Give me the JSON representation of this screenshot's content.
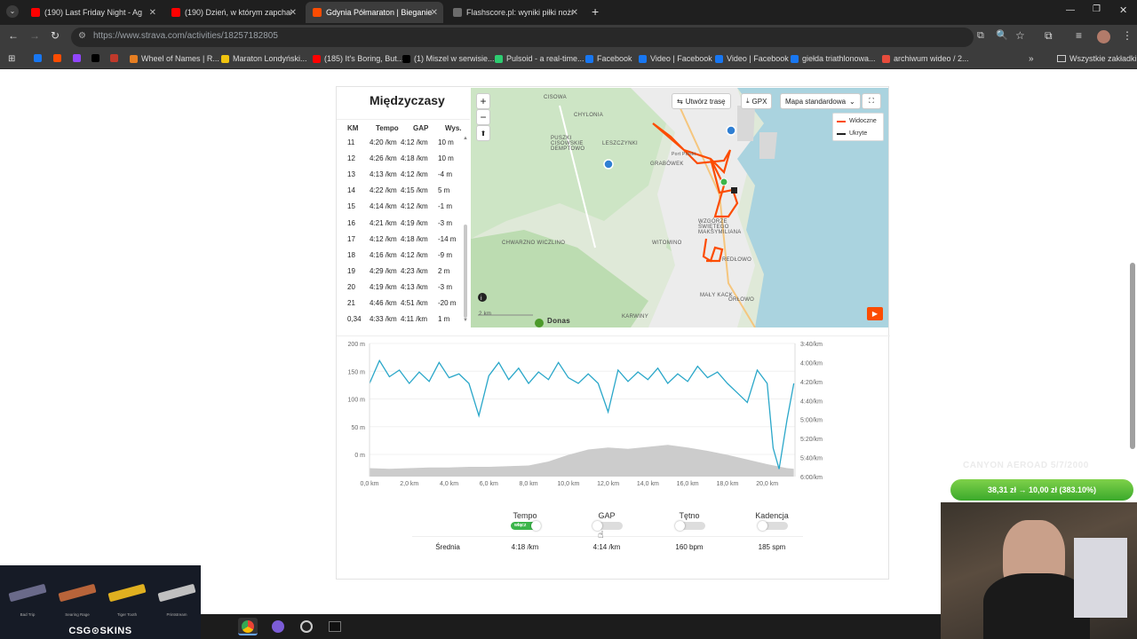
{
  "browser": {
    "tabs": [
      {
        "title": "(190) Last Friday Night - Ag",
        "icon": "youtube-icon",
        "color": "#ff0000",
        "active": false
      },
      {
        "title": "(190) Dzień, w którym zapchał",
        "icon": "youtube-icon",
        "color": "#ff0000",
        "active": false
      },
      {
        "title": "Gdynia Półmaraton | Bieganie |",
        "icon": "strava-icon",
        "color": "#fc4c02",
        "active": true
      },
      {
        "title": "Flashscore.pl: wyniki piłki nożne",
        "icon": "flashscore-icon",
        "color": "#6c6c6c",
        "active": false
      }
    ],
    "url": "https://www.strava.com/activities/18257182805",
    "bookmarks": [
      {
        "label": "",
        "icon": "facebook-icon",
        "color": "#1877f2"
      },
      {
        "label": "",
        "icon": "strava-icon",
        "color": "#fc4c02"
      },
      {
        "label": "",
        "icon": "twitch-icon",
        "color": "#9146ff"
      },
      {
        "label": "",
        "icon": "x-icon",
        "color": "#000000"
      },
      {
        "label": "",
        "icon": "bookmark-icon",
        "color": "#c0392b"
      },
      {
        "label": "Wheel of Names | R...",
        "icon": "wheel-icon",
        "color": "#e67e22"
      },
      {
        "label": "Maraton Londyński...",
        "icon": "runner-icon",
        "color": "#f1c40f"
      },
      {
        "label": "(185) It's Boring, But...",
        "icon": "youtube-icon",
        "color": "#ff0000"
      },
      {
        "label": "(1) Miszel w serwisie...",
        "icon": "x-icon",
        "color": "#000000"
      },
      {
        "label": "Pulsoid - a real-time...",
        "icon": "pulsoid-icon",
        "color": "#2ecc71"
      },
      {
        "label": "Facebook",
        "icon": "facebook-icon",
        "color": "#1877f2"
      },
      {
        "label": "Video | Facebook",
        "icon": "facebook-icon",
        "color": "#1877f2"
      },
      {
        "label": "Video | Facebook",
        "icon": "facebook-icon",
        "color": "#1877f2"
      },
      {
        "label": "giełda triathlonowa...",
        "icon": "facebook-icon",
        "color": "#1877f2"
      },
      {
        "label": "archiwum wideo / 2...",
        "icon": "live-icon",
        "color": "#e74c3c"
      }
    ],
    "all_bookmarks": "Wszystkie zakładki"
  },
  "splits": {
    "title": "Międzyczasy",
    "headers": [
      "KM",
      "Tempo",
      "GAP",
      "Wys."
    ],
    "rows": [
      [
        "11",
        "4:20 /km",
        "4:12 /km",
        "10 m"
      ],
      [
        "12",
        "4:26 /km",
        "4:18 /km",
        "10 m"
      ],
      [
        "13",
        "4:13 /km",
        "4:12 /km",
        "-4 m"
      ],
      [
        "14",
        "4:22 /km",
        "4:15 /km",
        "5 m"
      ],
      [
        "15",
        "4:14 /km",
        "4:12 /km",
        "-1 m"
      ],
      [
        "16",
        "4:21 /km",
        "4:19 /km",
        "-3 m"
      ],
      [
        "17",
        "4:12 /km",
        "4:18 /km",
        "-14 m"
      ],
      [
        "18",
        "4:16 /km",
        "4:12 /km",
        "-9 m"
      ],
      [
        "19",
        "4:29 /km",
        "4:23 /km",
        "2 m"
      ],
      [
        "20",
        "4:19 /km",
        "4:13 /km",
        "-3 m"
      ],
      [
        "21",
        "4:46 /km",
        "4:51 /km",
        "-20 m"
      ],
      [
        "0,34",
        "4:33 /km",
        "4:11 /km",
        "1 m"
      ]
    ]
  },
  "map": {
    "create_route": "Utwórz trasę",
    "gpx": "GPX",
    "map_type": "Mapa standardowa",
    "legend": [
      {
        "label": "Widoczne",
        "color": "#fc4c02"
      },
      {
        "label": "Ukryte",
        "color": "#222222"
      }
    ],
    "labels": [
      "CISOWA",
      "CHYLONIA",
      "PUSZKI CISOWSKIE DEMPTOWO",
      "LESZCZYNKI",
      "GRABÓWEK",
      "CHWARZNO WICZLINO",
      "WITOMINO",
      "WZGÓRZE ŚWIĘTEGO MAKSYMILIANA",
      "REDŁOWO",
      "MAŁY KACK",
      "ORŁOWO",
      "KARWINY",
      "Port Polski"
    ],
    "scale": "2 km",
    "poi": "Donas"
  },
  "chart_data": {
    "type": "line",
    "x_label": "km",
    "x_ticks": [
      "0,0 km",
      "2,0 km",
      "4,0 km",
      "6,0 km",
      "8,0 km",
      "10,0 km",
      "12,0 km",
      "14,0 km",
      "16,0 km",
      "18,0 km",
      "20,0 km"
    ],
    "y_left_ticks": [
      "200 m",
      "150 m",
      "100 m",
      "50 m",
      "0 m"
    ],
    "y_right_ticks": [
      "3:40/km",
      "4:00/km",
      "4:20/km",
      "4:40/km",
      "5:00/km",
      "5:20/km",
      "5:40/km",
      "6:00/km"
    ],
    "xlim": [
      0,
      21.4
    ],
    "elevation_ylim": [
      0,
      200
    ],
    "pace_ylim_sec": [
      220,
      360
    ],
    "series": [
      {
        "name": "Wysokość",
        "color": "#cccccc",
        "x": [
          0,
          1,
          2,
          3,
          4,
          5,
          6,
          7,
          8,
          9,
          10,
          11,
          12,
          13,
          14,
          15,
          16,
          17,
          18,
          19,
          20,
          21,
          21.34
        ],
        "values": [
          2,
          1,
          2,
          3,
          3,
          4,
          4,
          5,
          6,
          12,
          22,
          30,
          33,
          31,
          34,
          37,
          33,
          28,
          22,
          15,
          8,
          2,
          1
        ]
      },
      {
        "name": "Tempo",
        "color": "#2aa7c9",
        "x": [
          0,
          0.5,
          1,
          1.5,
          2,
          2.5,
          3,
          3.5,
          4,
          4.5,
          5,
          5.5,
          6,
          6.5,
          7,
          7.5,
          8,
          8.5,
          9,
          9.5,
          10,
          10.5,
          11,
          11.5,
          12,
          12.5,
          13,
          13.5,
          14,
          14.5,
          15,
          15.5,
          16,
          16.5,
          17,
          17.5,
          18,
          18.5,
          19,
          19.5,
          20,
          20.3,
          20.6,
          21,
          21.34
        ],
        "values": [
          262,
          238,
          255,
          248,
          262,
          250,
          260,
          240,
          256,
          252,
          262,
          296,
          254,
          240,
          258,
          246,
          262,
          250,
          258,
          240,
          256,
          262,
          252,
          262,
          292,
          248,
          260,
          250,
          258,
          246,
          262,
          252,
          260,
          244,
          256,
          250,
          262,
          272,
          282,
          248,
          262,
          330,
          352,
          300,
          262
        ]
      }
    ]
  },
  "stats": {
    "tempo_label": "Tempo",
    "gap_label": "GAP",
    "hr_label": "Tętno",
    "cad_label": "Kadencja",
    "toggle_on_text": "włącz",
    "avg_label": "Średnia",
    "tempo_val": "4:18 /km",
    "gap_val": "4:14 /km",
    "hr_val": "160 bpm",
    "cad_val": "185 spm"
  },
  "overlays": {
    "csgo_brand": "CSG⊙SKINS",
    "skins": [
      "Bad Trip",
      "Searing Rage",
      "Tiger Tooth",
      "Printstream"
    ],
    "canyon": "CANYON AEROAD 5/7/2000",
    "donation": "38,31 zł → 10,00 zł (383.10%)"
  }
}
